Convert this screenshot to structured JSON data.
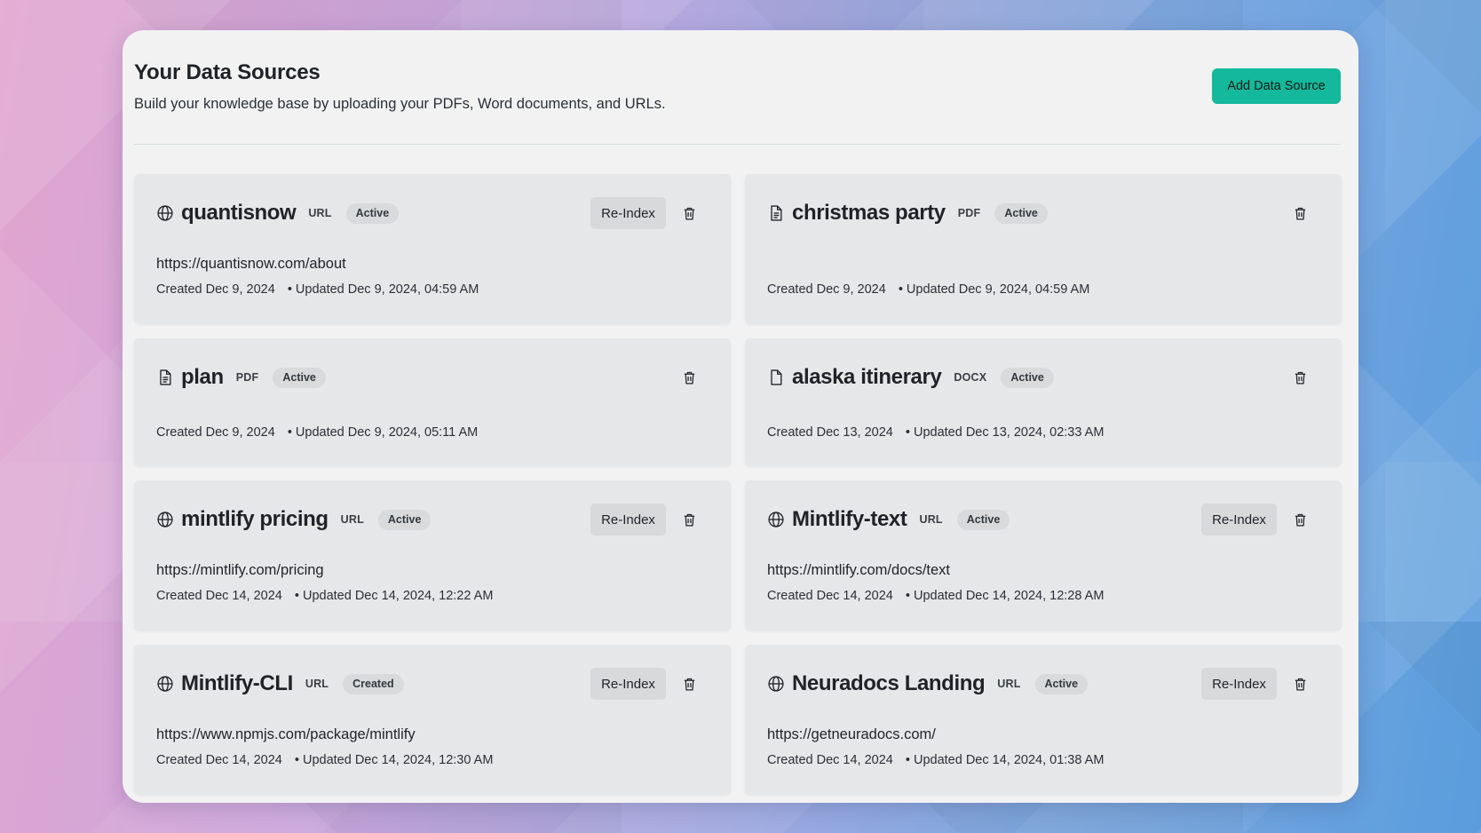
{
  "page": {
    "title": "Your Data Sources",
    "subtitle": "Build your knowledge base by uploading your PDFs, Word documents, and URLs.",
    "add_button": "Add Data Source",
    "reindex_label": "Re-Index",
    "accent_color": "#14b89b"
  },
  "sources": [
    {
      "icon": "globe-icon",
      "name": "quantisnow",
      "type": "URL",
      "status": "Active",
      "url": "https://quantisnow.com/about",
      "created": "Created Dec 9, 2024",
      "updated": "• Updated Dec 9, 2024, 04:59 AM",
      "reindex": true
    },
    {
      "icon": "document-icon",
      "name": "christmas party",
      "type": "PDF",
      "status": "Active",
      "url": "",
      "created": "Created Dec 9, 2024",
      "updated": "• Updated Dec 9, 2024, 04:59 AM",
      "reindex": false
    },
    {
      "icon": "document-icon",
      "name": "plan",
      "type": "PDF",
      "status": "Active",
      "url": "",
      "created": "Created Dec 9, 2024",
      "updated": "• Updated Dec 9, 2024, 05:11 AM",
      "reindex": false
    },
    {
      "icon": "file-icon",
      "name": "alaska itinerary",
      "type": "DOCX",
      "status": "Active",
      "url": "",
      "created": "Created Dec 13, 2024",
      "updated": "• Updated Dec 13, 2024, 02:33 AM",
      "reindex": false
    },
    {
      "icon": "globe-icon",
      "name": "mintlify pricing",
      "type": "URL",
      "status": "Active",
      "url": "https://mintlify.com/pricing",
      "created": "Created Dec 14, 2024",
      "updated": "• Updated Dec 14, 2024, 12:22 AM",
      "reindex": true
    },
    {
      "icon": "globe-icon",
      "name": "Mintlify-text",
      "type": "URL",
      "status": "Active",
      "url": "https://mintlify.com/docs/text",
      "created": "Created Dec 14, 2024",
      "updated": "• Updated Dec 14, 2024, 12:28 AM",
      "reindex": true
    },
    {
      "icon": "globe-icon",
      "name": "Mintlify-CLI",
      "type": "URL",
      "status": "Created",
      "url": "https://www.npmjs.com/package/mintlify",
      "created": "Created Dec 14, 2024",
      "updated": "• Updated Dec 14, 2024, 12:30 AM",
      "reindex": true
    },
    {
      "icon": "globe-icon",
      "name": "Neuradocs Landing",
      "type": "URL",
      "status": "Active",
      "url": "https://getneuradocs.com/",
      "created": "Created Dec 14, 2024",
      "updated": "• Updated Dec 14, 2024, 01:38 AM",
      "reindex": true
    }
  ]
}
